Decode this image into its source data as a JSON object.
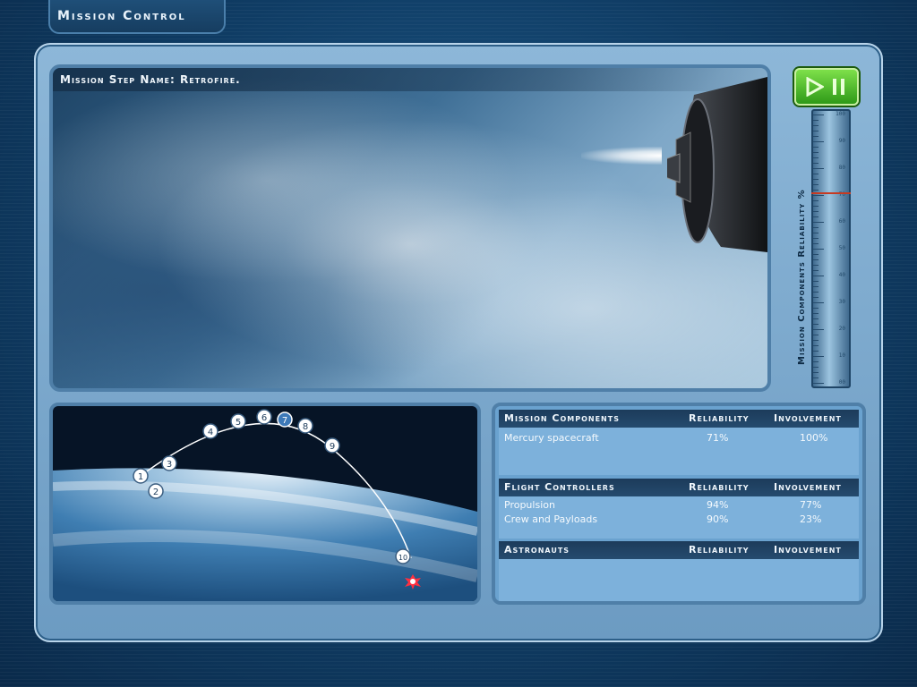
{
  "app": {
    "title": "Mission Control"
  },
  "mission": {
    "step_label": "Mission Step Name: Retrofire."
  },
  "controls": {
    "play_pause_icon": "play-pause-icon",
    "accent": "#4cc22a"
  },
  "gauge": {
    "label": "Mission Components Reliability %",
    "ticks": [
      "100",
      "90",
      "80",
      "70",
      "60",
      "50",
      "40",
      "30",
      "20",
      "10",
      "00"
    ],
    "level_percent": 71,
    "level_color": "#c63a22"
  },
  "trajectory": {
    "steps": [
      "1",
      "2",
      "3",
      "4",
      "5",
      "6",
      "7",
      "8",
      "9",
      "10"
    ],
    "current_step": "7"
  },
  "panels": {
    "mission_components": {
      "title": "Mission Components",
      "reliability_header": "Reliability",
      "involvement_header": "Involvement",
      "rows": [
        {
          "name": "Mercury spacecraft",
          "reliability": "71%",
          "involvement": "100%"
        }
      ]
    },
    "flight_controllers": {
      "title": "Flight Controllers",
      "reliability_header": "Reliability",
      "involvement_header": "Involvement",
      "rows": [
        {
          "name": "Propulsion",
          "reliability": "94%",
          "involvement": "77%"
        },
        {
          "name": "Crew and Payloads",
          "reliability": "90%",
          "involvement": "23%"
        }
      ]
    },
    "astronauts": {
      "title": "Astronauts",
      "reliability_header": "Reliability",
      "involvement_header": "Involvement",
      "rows": []
    }
  }
}
